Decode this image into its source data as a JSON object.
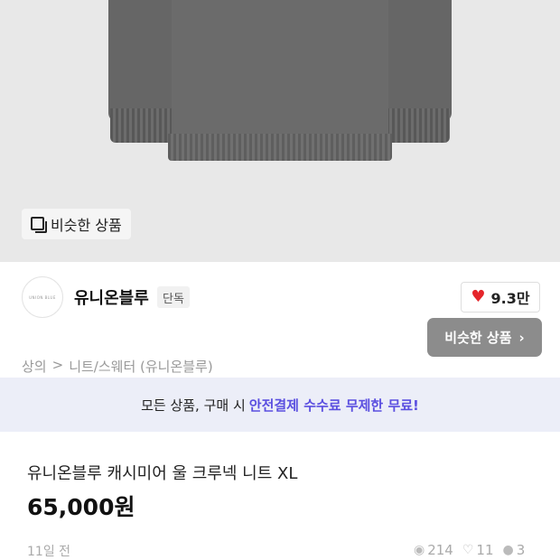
{
  "hero": {
    "similar_chip_label": "비슷한 상품"
  },
  "shop": {
    "logo_text": "UNION BLUE",
    "name": "유니온블루",
    "tag": "단독",
    "likes": "9.3만"
  },
  "similar_button": {
    "label": "비슷한 상품",
    "chevron": "›"
  },
  "breadcrumb": {
    "items": [
      "상의",
      ">",
      "니트/스웨터 (유니온블루)"
    ]
  },
  "banner": {
    "text": "모든 상품, 구매 시",
    "highlight": "안전결제 수수료 무제한 무료!"
  },
  "product": {
    "title": "유니온블루 캐시미어 울 크루넥 니트 XL",
    "price": "65,000원",
    "posted": "11일 전"
  },
  "stats": {
    "views": "214",
    "likes": "11",
    "chats": "3"
  },
  "colors": {
    "accent": "#5b4fe0",
    "heart": "#e5252a",
    "banner_bg": "#eceef8"
  }
}
